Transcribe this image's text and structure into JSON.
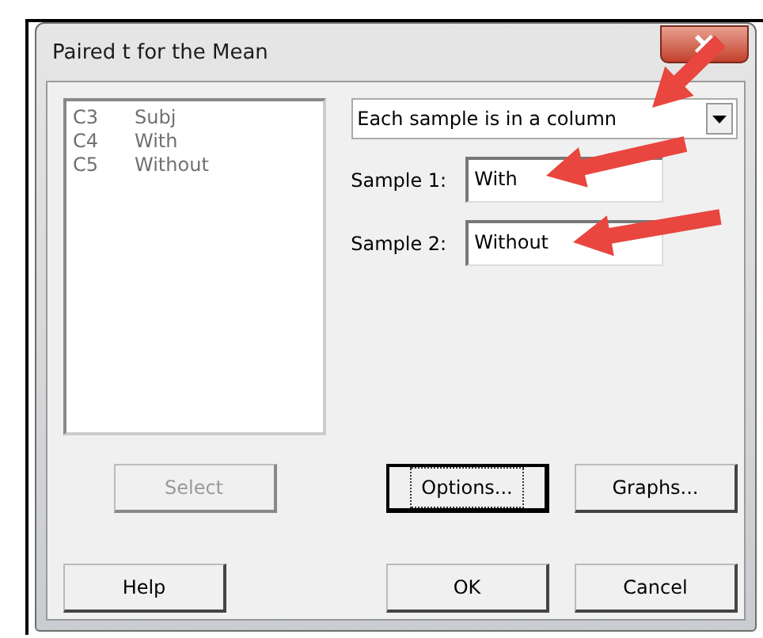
{
  "window": {
    "title": "Paired t for the Mean"
  },
  "variables": [
    {
      "column": "C3",
      "name": "Subj"
    },
    {
      "column": "C4",
      "name": "With"
    },
    {
      "column": "C5",
      "name": "Without"
    }
  ],
  "mode_dropdown": {
    "value": "Each sample is in a column"
  },
  "fields": [
    {
      "label": "Sample 1:",
      "value": "With"
    },
    {
      "label": "Sample 2:",
      "value": "Without"
    }
  ],
  "select_button": {
    "label": "Select",
    "disabled": true
  },
  "action_buttons": [
    {
      "label": "Options...",
      "focused": true
    },
    {
      "label": "Graphs...",
      "focused": false
    }
  ],
  "dialog_buttons": [
    {
      "label": "Help"
    },
    {
      "label": "OK"
    },
    {
      "label": "Cancel"
    }
  ]
}
